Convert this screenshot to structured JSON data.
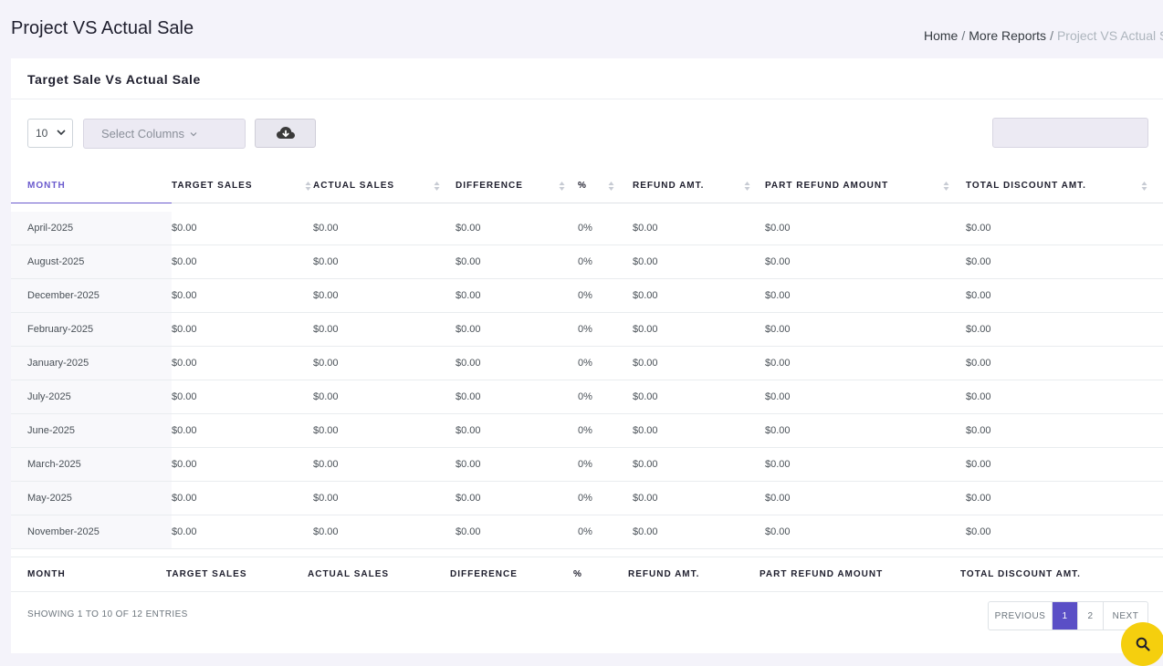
{
  "page": {
    "title": "Project VS Actual Sale",
    "breadcrumb": [
      "Home",
      "More Reports",
      "Project VS Actual Sale"
    ]
  },
  "card": {
    "title": "Target Sale Vs Actual Sale"
  },
  "toolbar": {
    "page_length": "10",
    "select_columns": "Select Columns",
    "download_icon": "cloud-download-icon",
    "search_value": ""
  },
  "table": {
    "columns": [
      "Month",
      "Target Sales",
      "Actual Sales",
      "Difference",
      "%",
      "Refund Amt.",
      "Part Refund Amount",
      "Total Discount Amt."
    ],
    "sorted_column": "Month",
    "rows": [
      [
        "April-2025",
        "$0.00",
        "$0.00",
        "$0.00",
        "0%",
        "$0.00",
        "$0.00",
        "$0.00"
      ],
      [
        "August-2025",
        "$0.00",
        "$0.00",
        "$0.00",
        "0%",
        "$0.00",
        "$0.00",
        "$0.00"
      ],
      [
        "December-2025",
        "$0.00",
        "$0.00",
        "$0.00",
        "0%",
        "$0.00",
        "$0.00",
        "$0.00"
      ],
      [
        "February-2025",
        "$0.00",
        "$0.00",
        "$0.00",
        "0%",
        "$0.00",
        "$0.00",
        "$0.00"
      ],
      [
        "January-2025",
        "$0.00",
        "$0.00",
        "$0.00",
        "0%",
        "$0.00",
        "$0.00",
        "$0.00"
      ],
      [
        "July-2025",
        "$0.00",
        "$0.00",
        "$0.00",
        "0%",
        "$0.00",
        "$0.00",
        "$0.00"
      ],
      [
        "June-2025",
        "$0.00",
        "$0.00",
        "$0.00",
        "0%",
        "$0.00",
        "$0.00",
        "$0.00"
      ],
      [
        "March-2025",
        "$0.00",
        "$0.00",
        "$0.00",
        "0%",
        "$0.00",
        "$0.00",
        "$0.00"
      ],
      [
        "May-2025",
        "$0.00",
        "$0.00",
        "$0.00",
        "0%",
        "$0.00",
        "$0.00",
        "$0.00"
      ],
      [
        "November-2025",
        "$0.00",
        "$0.00",
        "$0.00",
        "0%",
        "$0.00",
        "$0.00",
        "$0.00"
      ]
    ]
  },
  "footer": {
    "info": "SHOWING 1 TO 10 OF 12 ENTRIES",
    "pagination": {
      "previous": "PREVIOUS",
      "pages": [
        "1",
        "2"
      ],
      "current": "1",
      "next": "NEXT"
    }
  },
  "fab": {
    "icon": "search-icon"
  },
  "colors": {
    "accent": "#5a4fc6",
    "fab": "#f5cf0e",
    "page_bg": "#f4f3fa"
  }
}
